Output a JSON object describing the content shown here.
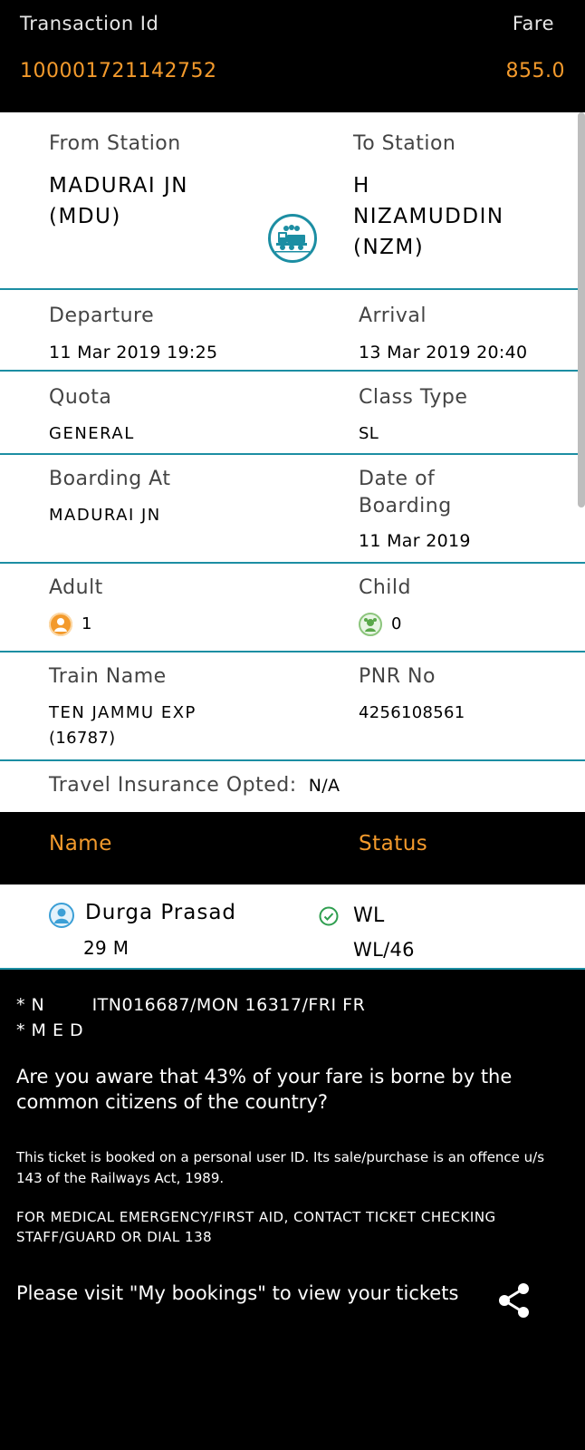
{
  "header": {
    "transaction_label": "Transaction Id",
    "fare_label": "Fare",
    "transaction_id": "100001721142752",
    "fare": "855.0"
  },
  "journey": {
    "from_label": "From Station",
    "from_line1": "MADURAI JN",
    "from_line2": "(MDU)",
    "to_label": "To Station",
    "to_line1": "H",
    "to_line2": "NIZAMUDDIN",
    "to_line3": "(NZM)",
    "train_icon": "train-icon"
  },
  "timing": {
    "departure_label": "Departure",
    "departure": "11 Mar 2019 19:25",
    "arrival_label": "Arrival",
    "arrival": "13 Mar 2019 20:40"
  },
  "quota": {
    "quota_label": "Quota",
    "quota": "GENERAL",
    "class_label": "Class Type",
    "class": "SL"
  },
  "boarding": {
    "boarding_label": "Boarding At",
    "boarding": "MADURAI JN",
    "date_label_line1": "Date of",
    "date_label_line2": "Boarding",
    "date": "11 Mar 2019"
  },
  "passengers_count": {
    "adult_label": "Adult",
    "adult": "1",
    "child_label": "Child",
    "child": "0"
  },
  "train": {
    "name_label": "Train Name",
    "name_line1": "TEN JAMMU EXP",
    "name_line2": "(16787)",
    "pnr_label": "PNR No",
    "pnr": "4256108561"
  },
  "insurance": {
    "label": "Travel Insurance Opted:",
    "value": "N/A"
  },
  "passenger_table": {
    "name_header": "Name",
    "status_header": "Status",
    "rows": [
      {
        "name": "Durga Prasad",
        "details": "29 M",
        "status": "WL",
        "current_status": "WL/46"
      }
    ]
  },
  "footer": {
    "code_line1": "* N        ITN016687/MON 16317/FRI FR",
    "code_line2": "* M E D",
    "fare_note": "Are you aware that 43% of your fare is borne by the common citizens of the country?",
    "legal_note": "This ticket is booked on a personal user ID. Its sale/purchase is an offence u/s 143 of the Railways Act, 1989.",
    "medical_note": "FOR MEDICAL EMERGENCY/FIRST AID, CONTACT TICKET CHECKING STAFF/GUARD OR DIAL 138",
    "bookings_note": "Please visit \"My bookings\" to view your tickets",
    "share_icon": "share-icon"
  },
  "colors": {
    "accent_orange": "#f39a2c",
    "teal_divider": "#1c8ea3",
    "status_green": "#2e9e4f"
  }
}
